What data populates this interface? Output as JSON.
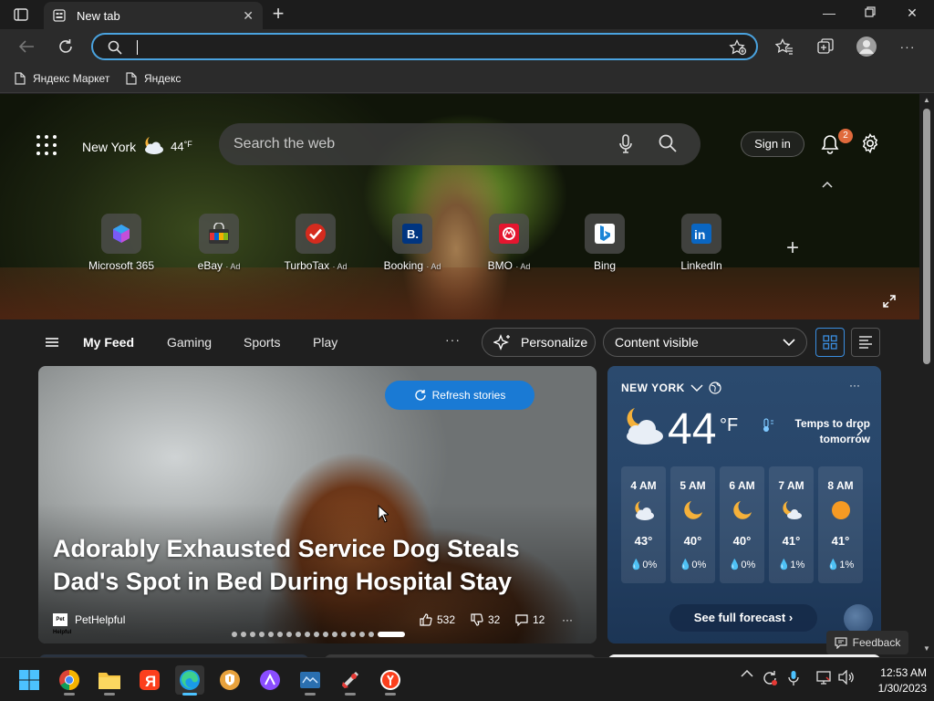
{
  "browser": {
    "tab_title": "New tab",
    "address_value": "",
    "bookmarks": [
      "Яндекс Маркет",
      "Яндекс"
    ]
  },
  "header": {
    "city": "New York",
    "temp": "44",
    "unit": "°F",
    "search_placeholder": "Search the web",
    "signin": "Sign in",
    "notifications": "2"
  },
  "tiles": [
    {
      "label": "Microsoft 365",
      "ad": ""
    },
    {
      "label": "eBay",
      "ad": "· Ad"
    },
    {
      "label": "TurboTax",
      "ad": "· Ad"
    },
    {
      "label": "Booking",
      "ad": "· Ad"
    },
    {
      "label": "BMO",
      "ad": "· Ad"
    },
    {
      "label": "Bing",
      "ad": ""
    },
    {
      "label": "LinkedIn",
      "ad": ""
    }
  ],
  "feednav": {
    "items": [
      "My Feed",
      "Gaming",
      "Sports",
      "Play"
    ],
    "more": "···",
    "personalize": "Personalize",
    "content_visible": "Content visible"
  },
  "story": {
    "refresh": "Refresh stories",
    "headline": "Adorably Exhausted Service Dog Steals Dad's Spot in Bed During Hospital Stay",
    "source": "PetHelpful",
    "source_logo": "Pet Helpful",
    "likes": "532",
    "dislikes": "32",
    "comments": "12",
    "more": "···"
  },
  "weather": {
    "city": "NEW YORK",
    "temp": "44",
    "unit": "°F",
    "alert": "Temps to drop tomorrow",
    "more": "···",
    "hours": [
      {
        "time": "4 AM",
        "temp": "43°",
        "precip": "0%",
        "icon": "partly-cloudy-night-icon"
      },
      {
        "time": "5 AM",
        "temp": "40°",
        "precip": "0%",
        "icon": "moon-icon"
      },
      {
        "time": "6 AM",
        "temp": "40°",
        "precip": "0%",
        "icon": "moon-icon"
      },
      {
        "time": "7 AM",
        "temp": "41°",
        "precip": "1%",
        "icon": "partly-cloudy-night-icon"
      },
      {
        "time": "8 AM",
        "temp": "41°",
        "precip": "1%",
        "icon": "sun-icon"
      }
    ],
    "full_forecast": "See full forecast"
  },
  "feedback": "Feedback",
  "clock": {
    "time": "12:53 AM",
    "date": "1/30/2023"
  },
  "colors": {
    "accent": "#1a7ad4",
    "address_border": "#4aa3df",
    "badge": "#e06a3c"
  }
}
